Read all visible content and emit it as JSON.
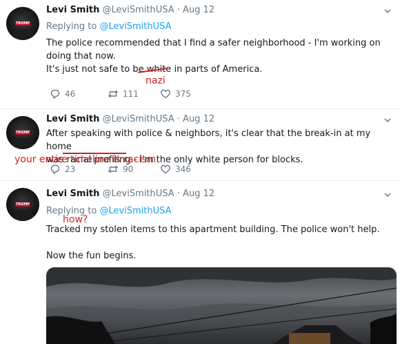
{
  "tweets": [
    {
      "name": "Levi Smith",
      "handle": "@LeviSmithUSA",
      "dot": "·",
      "date": "Aug 12",
      "replying_prefix": "Replying to",
      "replying_to": "@LeviSmithUSA",
      "line1": "The police recommended that I find a safer neighborhood - I'm working on doing that now.",
      "line2_before": "It's just not safe to be",
      "line2_struck": "white",
      "line2_after": "in parts of America.",
      "replies": "46",
      "retweets": "111",
      "likes": "375"
    },
    {
      "name": "Levi Smith",
      "handle": "@LeviSmithUSA",
      "dot": "·",
      "date": "Aug 12",
      "line1": "After speaking with police & neighbors, it's clear that the break-in at my home",
      "line2_before": "was",
      "line2_underlined": "racial profiling",
      "line2_after": "- I'm the only white person for blocks.",
      "replies": "23",
      "retweets": "90",
      "likes": "346"
    },
    {
      "name": "Levi Smith",
      "handle": "@LeviSmithUSA",
      "dot": "·",
      "date": "Aug 12",
      "replying_prefix": "Replying to",
      "replying_to": "@LeviSmithUSA",
      "line1": "Tracked my stolen items to this apartment building. The police won't help.",
      "line2": "Now the fun begins."
    }
  ],
  "annotations": {
    "nazi": "nazi",
    "timeline": "your entire timeline is racism",
    "how": "how?"
  },
  "avatar_badge": "TRUMP",
  "colors": {
    "link": "#1da1f2",
    "muted": "#657786",
    "annotation": "#d32121"
  },
  "icons": [
    "reply-icon",
    "retweet-icon",
    "like-icon",
    "caret-down-icon"
  ]
}
